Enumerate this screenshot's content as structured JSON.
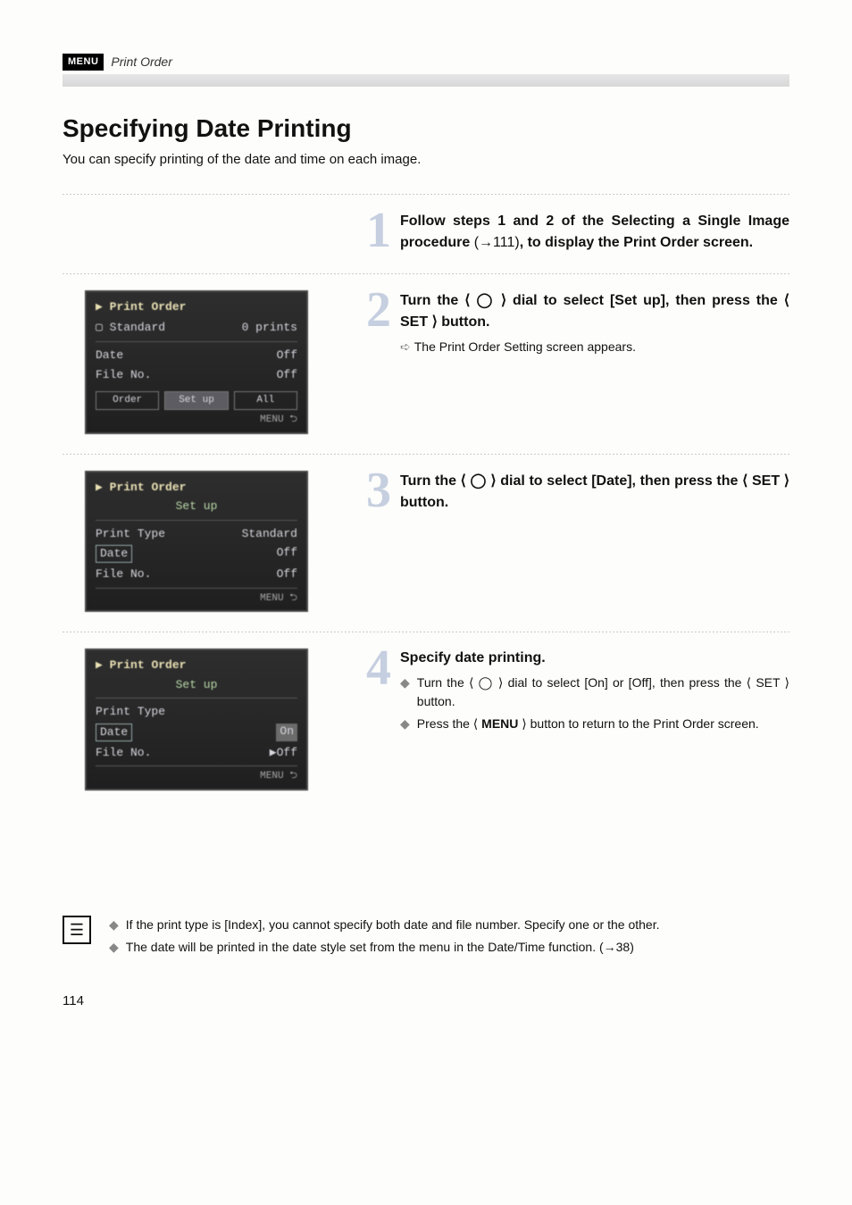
{
  "header": {
    "menu_badge": "MENU",
    "breadcrumb": "Print Order"
  },
  "title": "Specifying Date Printing",
  "intro": "You can specify printing of the date and time on each image.",
  "step1": {
    "num": "1",
    "lead_a": "Follow steps 1 and 2 of the Selecting a Single Image procedure",
    "lead_ref": "(→111)",
    "lead_b": ", to display the Print Order screen."
  },
  "step2": {
    "num": "2",
    "lead": "Turn the ⟨ ◯ ⟩ dial to select [Set up], then press the ⟨ SET ⟩ button.",
    "sub": "The Print Order Setting screen appears.",
    "lcd": {
      "title": "Print Order",
      "sub1": "Standard",
      "sub2": "0 prints",
      "r1k": "Date",
      "r1v": "Off",
      "r2k": "File No.",
      "r2v": "Off",
      "tab1": "Order",
      "tab2": "Set up",
      "tab3": "All",
      "foot": "MENU ⮌"
    }
  },
  "step3": {
    "num": "3",
    "lead": "Turn the ⟨ ◯ ⟩ dial to select [Date], then press the ⟨ SET ⟩ button.",
    "lcd": {
      "title": "Print Order",
      "sub": "Set up",
      "r1k": "Print Type",
      "r1v": "Standard",
      "r2k": "Date",
      "r2v": "Off",
      "r3k": "File No.",
      "r3v": "Off",
      "foot": "MENU ⮌"
    }
  },
  "step4": {
    "num": "4",
    "heading": "Specify date printing.",
    "b1": "Turn the ⟨ ◯ ⟩ dial to select [On] or [Off], then press the ⟨ SET ⟩ button.",
    "b2a": "Press the ⟨",
    "b2b": "MENU",
    "b2c": "⟩ button to return to the Print Order screen.",
    "lcd": {
      "title": "Print Order",
      "sub": "Set up",
      "r1k": "Print Type",
      "r1v": "",
      "r2k": "Date",
      "r2v": "On",
      "r3k": "File No.",
      "r3v": "▶Off",
      "foot": "MENU ⮌"
    }
  },
  "notes": {
    "n1": "If the print type is [Index], you cannot specify both date and file number. Specify one or the other.",
    "n2": "The date will be printed in the date style set from the menu in the Date/Time function. (→38)"
  },
  "page_number": "114"
}
